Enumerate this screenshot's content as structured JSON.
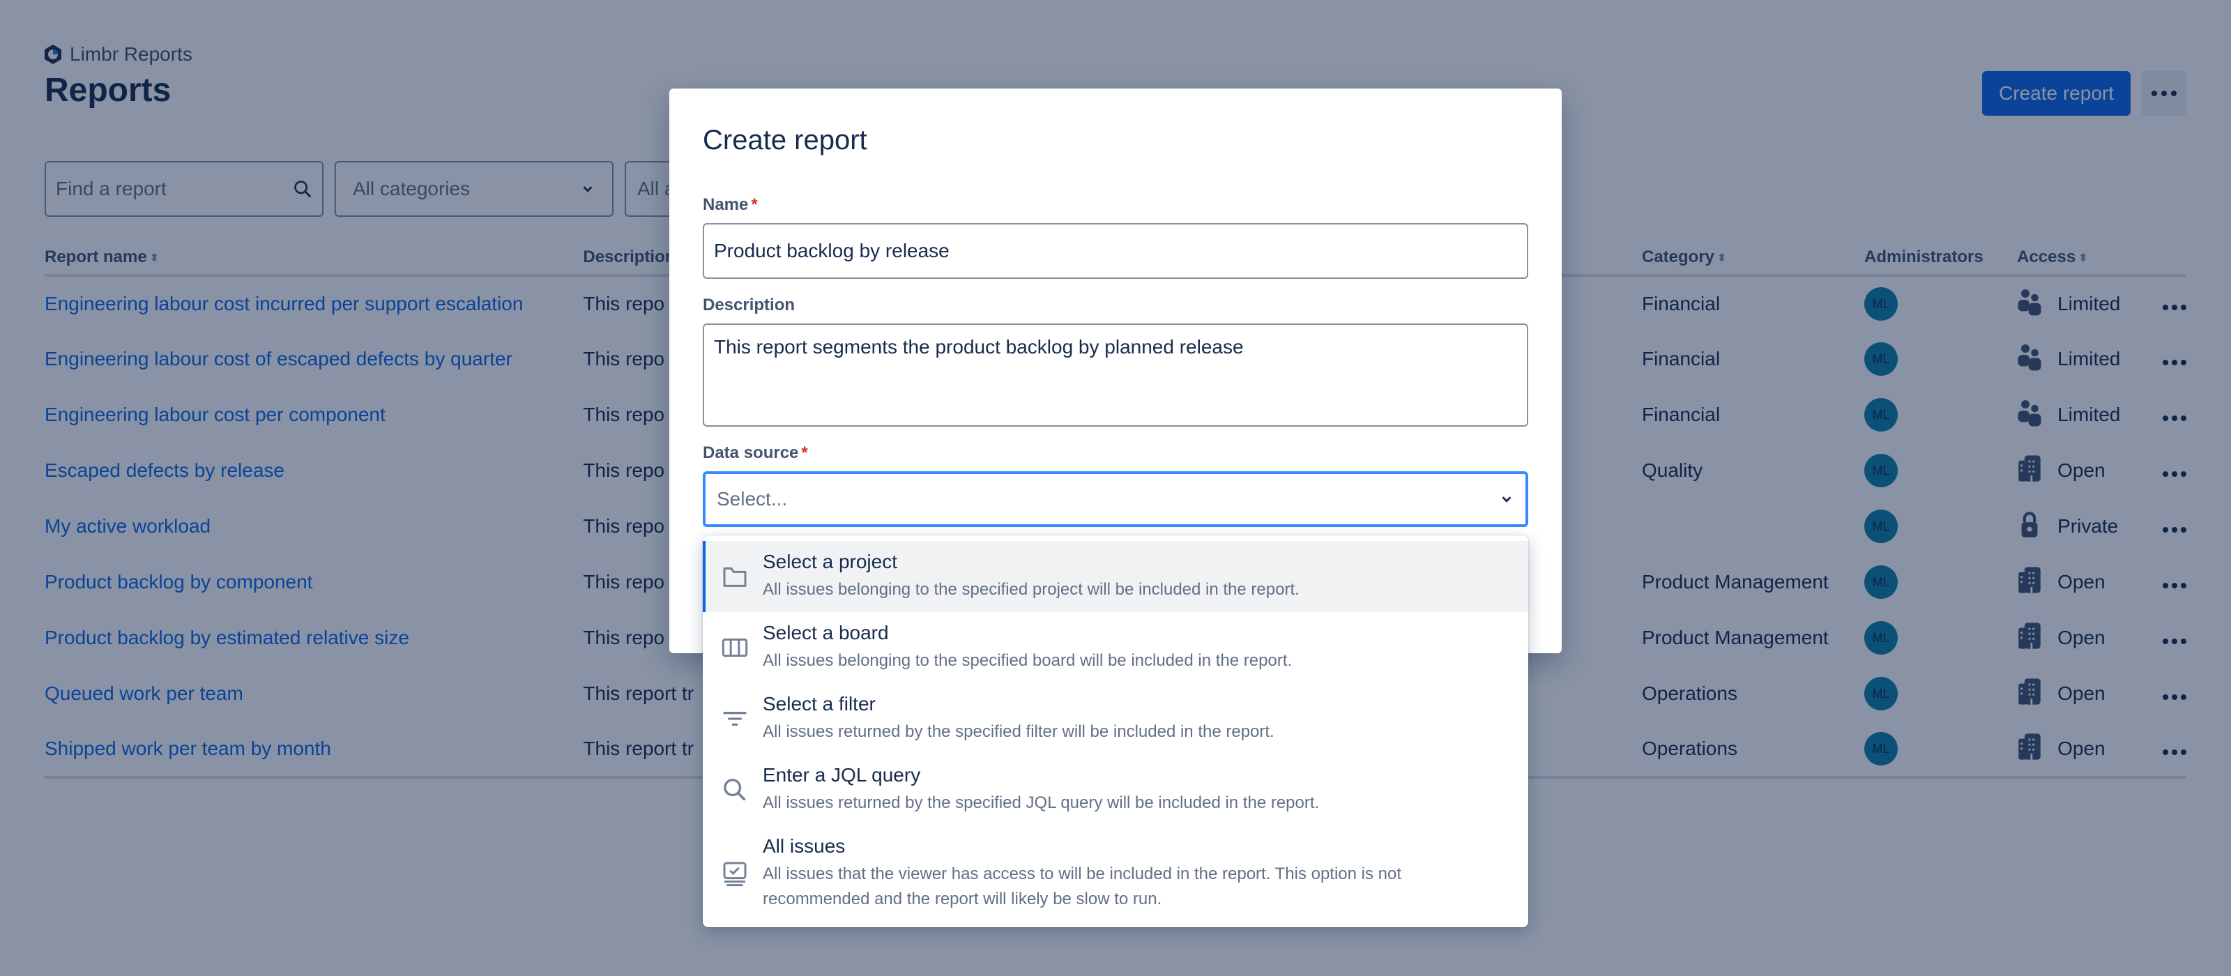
{
  "brand": {
    "name": "Limbr Reports",
    "icon": "limbr-logo-icon"
  },
  "page": {
    "title": "Reports"
  },
  "header": {
    "create_label": "Create report",
    "more_icon": "more-horizontal-icon"
  },
  "filters": {
    "search_placeholder": "Find a report",
    "category_value": "All categories",
    "third_value": "All a"
  },
  "table": {
    "columns": [
      "Report name",
      "Description",
      "Category",
      "Administrators",
      "Access"
    ],
    "rows": [
      {
        "name": "Engineering labour cost incurred per support escalation",
        "description": "This repo",
        "category": "Financial",
        "admin": "ML",
        "access": "Limited",
        "access_icon": "people-icon"
      },
      {
        "name": "Engineering labour cost of escaped defects by quarter",
        "description": "This repo",
        "category": "Financial",
        "admin": "ML",
        "access": "Limited",
        "access_icon": "people-icon"
      },
      {
        "name": "Engineering labour cost per component",
        "description": "This repo",
        "category": "Financial",
        "admin": "ML",
        "access": "Limited",
        "access_icon": "people-icon"
      },
      {
        "name": "Escaped defects by release",
        "description": "This repo",
        "category": "Quality",
        "admin": "ML",
        "access": "Open",
        "access_icon": "office-building-icon"
      },
      {
        "name": "My active workload",
        "description": "This repo",
        "category": "",
        "admin": "ML",
        "access": "Private",
        "access_icon": "lock-icon"
      },
      {
        "name": "Product backlog by component",
        "description": "This repo",
        "category": "Product Management",
        "admin": "ML",
        "access": "Open",
        "access_icon": "office-building-icon"
      },
      {
        "name": "Product backlog by estimated relative size",
        "description": "This repo",
        "category": "Product Management",
        "admin": "ML",
        "access": "Open",
        "access_icon": "office-building-icon"
      },
      {
        "name": "Queued work per team",
        "description": "This report tr",
        "category": "Operations",
        "admin": "ML",
        "access": "Open",
        "access_icon": "office-building-icon"
      },
      {
        "name": "Shipped work per team by month",
        "description": "This report tr",
        "category": "Operations",
        "admin": "ML",
        "access": "Open",
        "access_icon": "office-building-icon"
      }
    ]
  },
  "modal": {
    "title": "Create report",
    "name_label": "Name",
    "name_value": "Product backlog by release",
    "description_label": "Description",
    "description_value": "This report segments the product backlog by planned release",
    "datasource_label": "Data source",
    "datasource_placeholder": "Select...",
    "required_mark": "*",
    "options": [
      {
        "icon": "folder-icon",
        "title": "Select a project",
        "desc": "All issues belonging to the specified project will be included in the report.",
        "active": true
      },
      {
        "icon": "board-icon",
        "title": "Select a board",
        "desc": "All issues belonging to the specified board will be included in the report."
      },
      {
        "icon": "filter-icon",
        "title": "Select a filter",
        "desc": "All issues returned by the specified filter will be included in the report."
      },
      {
        "icon": "search-icon",
        "title": "Enter a JQL query",
        "desc": "All issues returned by the specified JQL query will be included in the report."
      },
      {
        "icon": "issues-icon",
        "title": "All issues",
        "desc": "All issues that the viewer has access to will be included in the report. This option is not recommended and the report will likely be slow to run."
      }
    ]
  },
  "colors": {
    "brand": "#0c66e4",
    "avatar": "#0e7fa8",
    "overlay": "rgba(9,30,66,0.48)"
  }
}
